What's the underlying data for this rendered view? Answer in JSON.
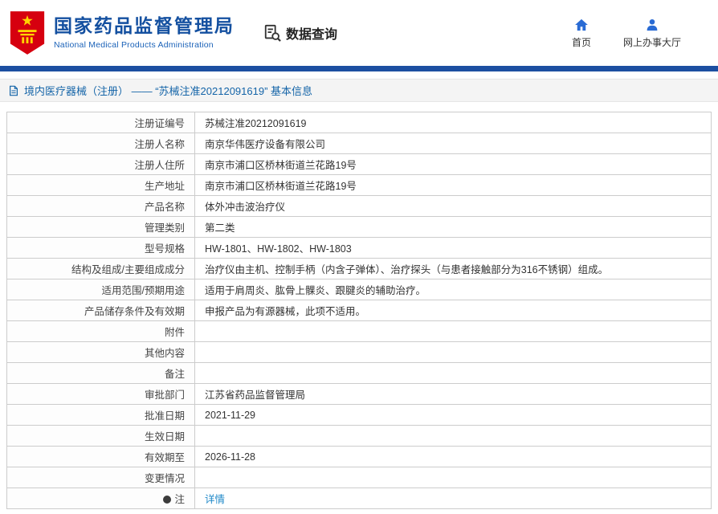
{
  "header": {
    "org_name_cn": "国家药品监督管理局",
    "org_name_en": "National Medical Products Administration",
    "nav_title": "数据查询",
    "home_label": "首页",
    "hall_label": "网上办事大厅"
  },
  "breadcrumb": {
    "text": "境内医疗器械（注册） ——  “苏械注准20212091619”  基本信息"
  },
  "icons": {
    "nmpa-emblem-icon": "red shield with yellow star and gate",
    "data-query-icon": "document with magnifier",
    "home-icon": "house",
    "user-icon": "person silhouette",
    "document-icon": "page with folded corner",
    "note-bullet-icon": "dark filled circle"
  },
  "colors": {
    "brand_blue": "#1450a0",
    "bar_blue": "#1c4fa1",
    "breadcrumb_blue": "#1464a8",
    "link_blue": "#1e88c8",
    "emblem_red": "#d6000f",
    "emblem_yellow": "#ffd400"
  },
  "table": {
    "rows": [
      {
        "label": "注册证编号",
        "value": "苏械注准20212091619"
      },
      {
        "label": "注册人名称",
        "value": "南京华伟医疗设备有限公司"
      },
      {
        "label": "注册人住所",
        "value": "南京市浦口区桥林街道兰花路19号"
      },
      {
        "label": "生产地址",
        "value": "南京市浦口区桥林街道兰花路19号"
      },
      {
        "label": "产品名称",
        "value": "体外冲击波治疗仪"
      },
      {
        "label": "管理类别",
        "value": "第二类"
      },
      {
        "label": "型号规格",
        "value": "HW-1801、HW-1802、HW-1803"
      },
      {
        "label": "结构及组成/主要组成成分",
        "value": "治疗仪由主机、控制手柄（内含子弹体）、治疗探头（与患者接触部分为316不锈钢）组成。"
      },
      {
        "label": "适用范围/预期用途",
        "value": "适用于肩周炎、肱骨上髁炎、跟腱炎的辅助治疗。"
      },
      {
        "label": "产品储存条件及有效期",
        "value": "申报产品为有源器械，此项不适用。"
      },
      {
        "label": "附件",
        "value": ""
      },
      {
        "label": "其他内容",
        "value": ""
      },
      {
        "label": "备注",
        "value": ""
      },
      {
        "label": "审批部门",
        "value": "江苏省药品监督管理局"
      },
      {
        "label": "批准日期",
        "value": "2021-11-29"
      },
      {
        "label": "生效日期",
        "value": ""
      },
      {
        "label": "有效期至",
        "value": "2026-11-28"
      },
      {
        "label": "变更情况",
        "value": ""
      },
      {
        "label": "注",
        "value": "详情",
        "link": true,
        "bullet": true
      }
    ]
  }
}
